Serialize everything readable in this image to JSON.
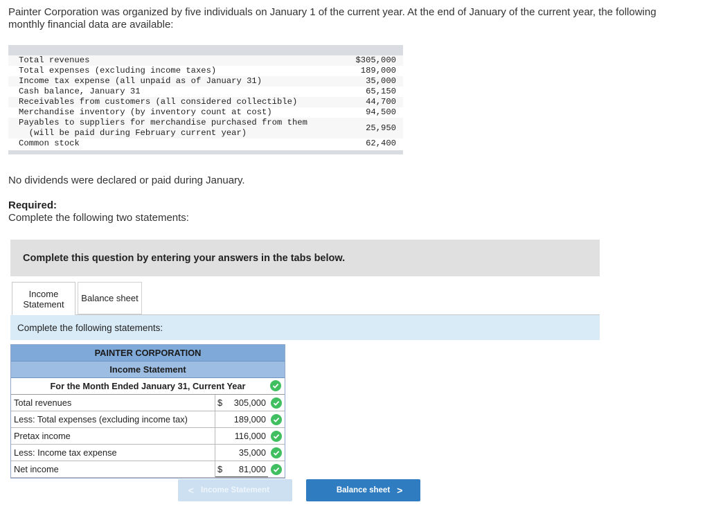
{
  "intro": "Painter Corporation was organized by five individuals on January 1 of the current year. At the end of January of the current year, the following monthly financial data are available:",
  "data_table": {
    "rows": [
      {
        "label": "Total revenues",
        "value": "$305,000"
      },
      {
        "label": "Total expenses (excluding income taxes)",
        "value": "189,000"
      },
      {
        "label": "Income tax expense (all unpaid as of January 31)",
        "value": "35,000"
      },
      {
        "label": "Cash balance, January 31",
        "value": "65,150"
      },
      {
        "label": "Receivables from customers (all considered collectible)",
        "value": "44,700"
      },
      {
        "label": "Merchandise inventory (by inventory count at cost)",
        "value": "94,500"
      },
      {
        "label": "Payables to suppliers for merchandise purchased from them\n  (will be paid during February current year)",
        "value": "25,950"
      },
      {
        "label": "Common stock",
        "value": "62,400"
      }
    ]
  },
  "no_dividends": "No dividends were declared or paid during January.",
  "required_title": "Required:",
  "required_text": "Complete the following two statements:",
  "banner": "Complete this question by entering your answers in the tabs below.",
  "tabs": {
    "income_line1": "Income",
    "income_line2": "Statement",
    "balance": "Balance sheet"
  },
  "instructions": "Complete the following statements:",
  "statement": {
    "company": "PAINTER CORPORATION",
    "title": "Income Statement",
    "period": "For the Month Ended January 31, Current Year",
    "rows": [
      {
        "label": "Total revenues",
        "dollar": "$",
        "amount": "305,000"
      },
      {
        "label": "Less: Total expenses (excluding income tax)",
        "dollar": "",
        "amount": "189,000"
      },
      {
        "label": "Pretax income",
        "dollar": "",
        "amount": "116,000"
      },
      {
        "label": "Less: Income tax expense",
        "dollar": "",
        "amount": "35,000"
      },
      {
        "label": "Net income",
        "dollar": "$",
        "amount": "81,000"
      }
    ]
  },
  "nav": {
    "prev_label": "Income Statement",
    "next_label": "Balance sheet",
    "prev_arrow": "<",
    "next_arrow": ">"
  },
  "colors": {
    "check": "#3fbf5f",
    "header_blue": "#7fa9d9",
    "next_button": "#2f7dc0"
  }
}
